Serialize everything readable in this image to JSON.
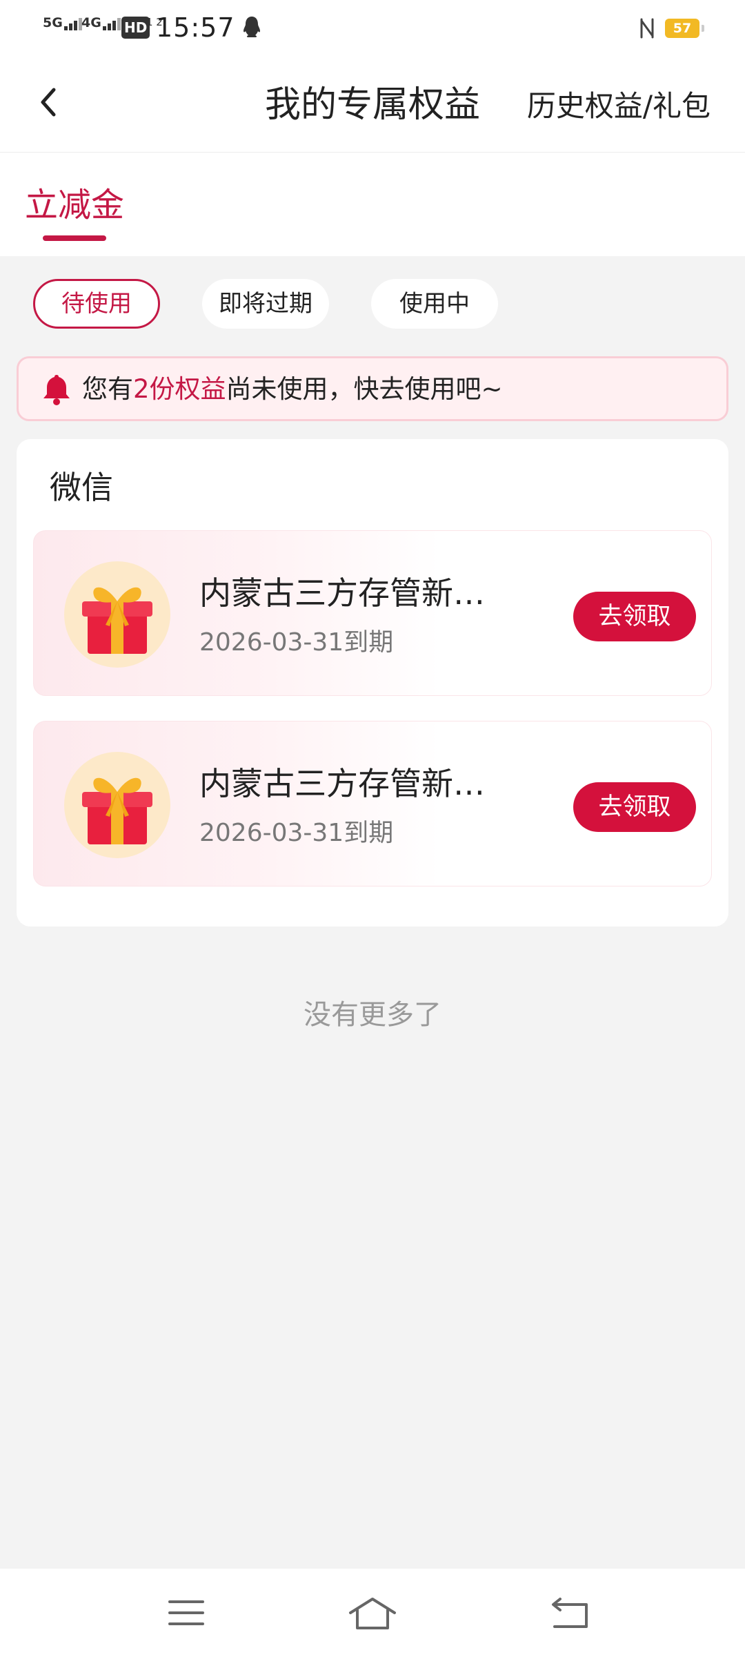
{
  "status_bar": {
    "network1": "5G",
    "network2": "4G",
    "hd_label": "HD",
    "hd_sub": "1 2",
    "time": "15:57",
    "battery": "57"
  },
  "nav": {
    "title": "我的专属权益",
    "history_link": "历史权益/礼包"
  },
  "tabs": [
    {
      "label": "立减金",
      "active": true
    }
  ],
  "filters": [
    {
      "label": "待使用",
      "active": true
    },
    {
      "label": "即将过期",
      "active": false
    },
    {
      "label": "使用中",
      "active": false
    }
  ],
  "notice": {
    "prefix": "您有",
    "highlight": "2份权益",
    "suffix": "尚未使用，快去使用吧~"
  },
  "section": {
    "title": "微信",
    "items": [
      {
        "name": "内蒙古三方存管新…",
        "expiry": "2026-03-31到期",
        "button": "去领取"
      },
      {
        "name": "内蒙古三方存管新…",
        "expiry": "2026-03-31到期",
        "button": "去领取"
      }
    ]
  },
  "footer": {
    "no_more": "没有更多了"
  },
  "colors": {
    "accent": "#c41845",
    "button": "#d4113c",
    "notice_bg": "#fff0f2",
    "page_bg": "#f3f3f3"
  },
  "icons": {
    "back": "chevron-left-icon",
    "bell": "bell-icon",
    "gift": "gift-icon",
    "menu": "menu-icon",
    "home": "home-icon",
    "return": "back-arrow-icon"
  }
}
